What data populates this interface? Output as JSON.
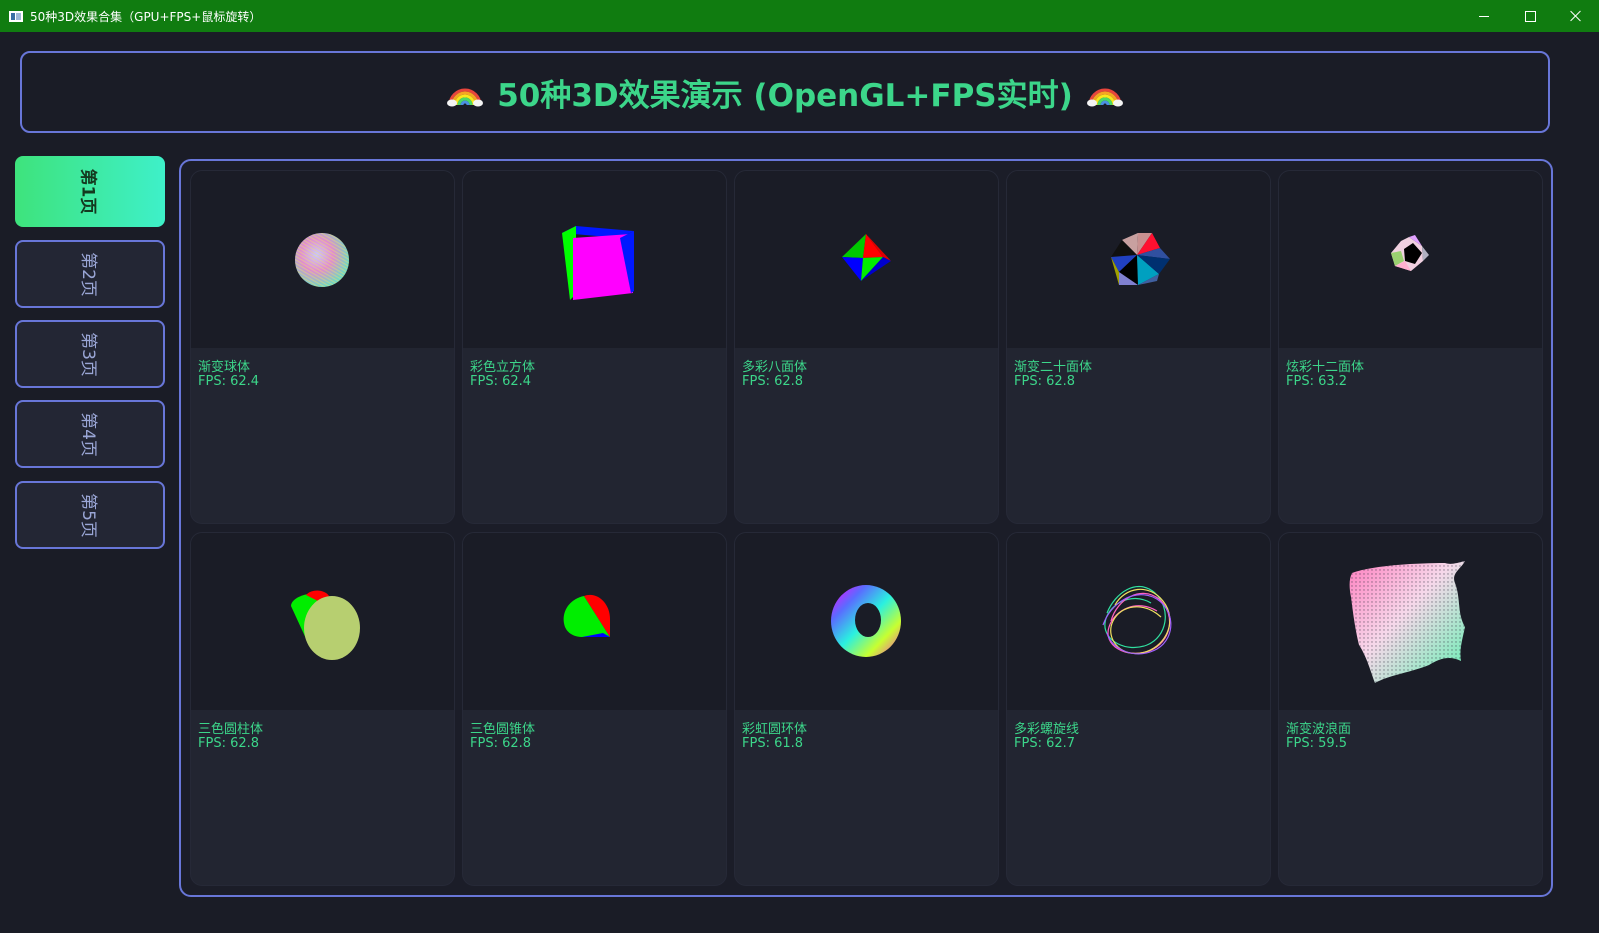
{
  "window": {
    "title": "50种3D效果合集（GPU+FPS+鼠标旋转）"
  },
  "header": {
    "title": "50种3D效果演示 (OpenGL+FPS实时)",
    "emoji_icon": "rainbow-icon"
  },
  "sidebar": {
    "pages": [
      {
        "label": "第1页",
        "active": true
      },
      {
        "label": "第2页",
        "active": false
      },
      {
        "label": "第3页",
        "active": false
      },
      {
        "label": "第4页",
        "active": false
      },
      {
        "label": "第5页",
        "active": false
      }
    ]
  },
  "cards": [
    {
      "name": "渐变球体",
      "fps": "FPS: 62.4",
      "shape": "sphere"
    },
    {
      "name": "彩色立方体",
      "fps": "FPS: 62.4",
      "shape": "cube"
    },
    {
      "name": "多彩八面体",
      "fps": "FPS: 62.8",
      "shape": "octahedron"
    },
    {
      "name": "渐变二十面体",
      "fps": "FPS: 62.8",
      "shape": "icosahedron"
    },
    {
      "name": "炫彩十二面体",
      "fps": "FPS: 63.2",
      "shape": "dodecahedron"
    },
    {
      "name": "三色圆柱体",
      "fps": "FPS: 62.8",
      "shape": "cylinder"
    },
    {
      "name": "三色圆锥体",
      "fps": "FPS: 62.8",
      "shape": "cone"
    },
    {
      "name": "彩虹圆环体",
      "fps": "FPS: 61.8",
      "shape": "torus"
    },
    {
      "name": "多彩螺旋线",
      "fps": "FPS: 62.7",
      "shape": "helix"
    },
    {
      "name": "渐变波浪面",
      "fps": "FPS: 59.5",
      "shape": "wave-surface"
    }
  ],
  "colors": {
    "accent_green": "#3cd68a",
    "border_blue": "#6876d8",
    "titlebar": "#107c10",
    "background": "#1a1c26"
  }
}
